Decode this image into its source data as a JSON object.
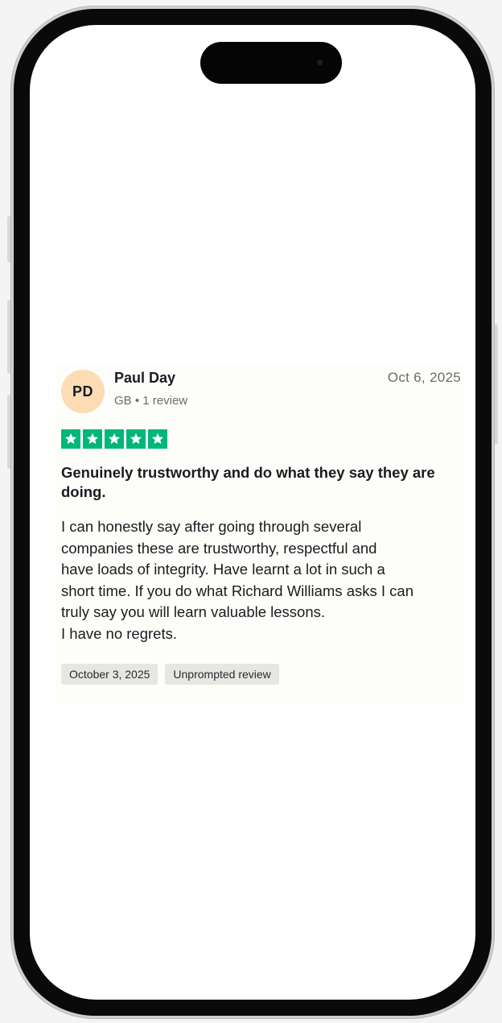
{
  "review": {
    "reviewer": {
      "initials": "PD",
      "name": "Paul Day",
      "meta": "GB • 1 review",
      "avatar_color": "#fbdcb4"
    },
    "date": "Oct 6, 2025",
    "rating": 5,
    "rating_max": 5,
    "star_color": "#00b67a",
    "title": "Genuinely trustworthy and do what they say they are doing.",
    "body_lines": [
      "I can honestly say after going through several",
      "companies these are trustworthy, respectful and",
      "have loads of integrity. Have learnt a lot in such a",
      "short time. If you do what Richard Williams asks I can",
      "truly say you will learn valuable lessons.",
      "I have no regrets."
    ],
    "tags": [
      "October 3, 2025",
      "Unprompted review"
    ]
  }
}
